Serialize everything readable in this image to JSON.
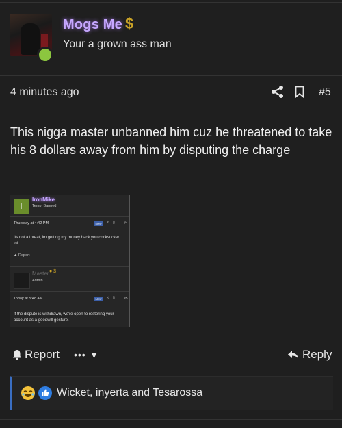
{
  "post": {
    "username": "Mogs Me",
    "user_badge_icon": "dollar-sign-icon",
    "user_title": "Your a grown ass man",
    "online_status_color": "#8cc63f",
    "timestamp": "4 minutes ago",
    "post_number": "#5",
    "body": "This nigga master unbanned him cuz he threatened to take his 8 dollars away from him by disputing the charge"
  },
  "embed": {
    "post1": {
      "avatar_letter": "I",
      "username": "IronMike",
      "user_title": "Temp. Banned",
      "timestamp": "Thursday at 4:42 PM",
      "badge": "New",
      "post_number": "#4",
      "text": "Its not a threat, im getting my money back you cocksucker lol",
      "report": "Report"
    },
    "post2": {
      "username": "Master",
      "user_title": "Admin",
      "timestamp": "Today at 5:48 AM",
      "badge": "New",
      "post_number": "#5",
      "text": "If the dispute is withdrawn, we're open to restoring your account as a goodwill gesture."
    }
  },
  "actions": {
    "report_label": "Report",
    "more_label": "•••",
    "reply_label": "Reply"
  },
  "reactions": {
    "icons": [
      "laughing-emoji-icon",
      "thumbs-up-icon"
    ],
    "reactors": "Wicket, inyerta and Tesarossa"
  },
  "colors": {
    "background": "#1f1f1f",
    "username": "#c6a7ff",
    "accent": "#3a6ec2"
  }
}
